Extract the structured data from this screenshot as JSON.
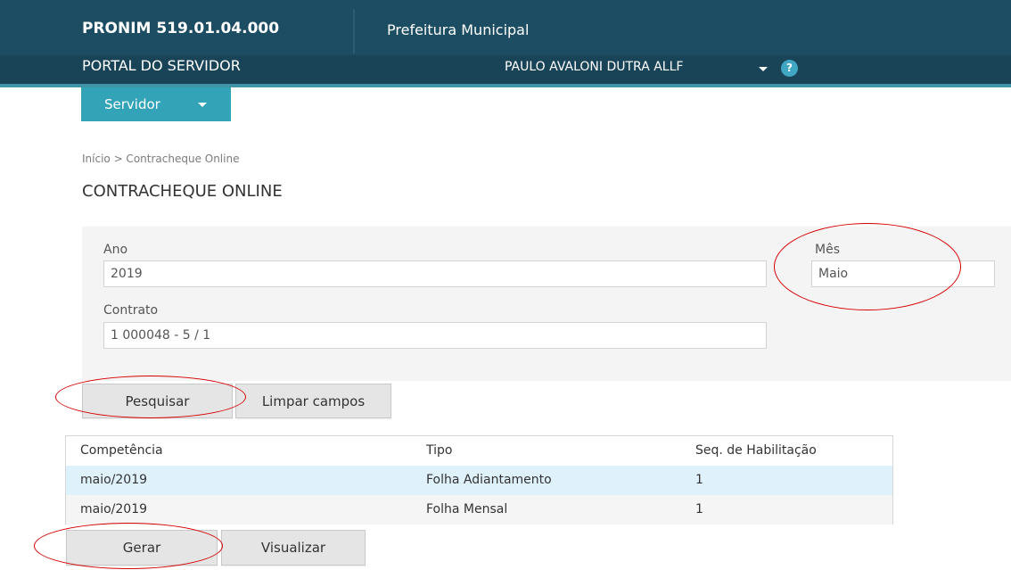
{
  "header": {
    "product": "PRONIM 519.01.04.000",
    "organization": "Prefeitura Municipal",
    "portal": "PORTAL DO SERVIDOR",
    "user": "PAULO AVALONI DUTRA ALLF",
    "help": "?"
  },
  "menu": {
    "servidor": "Servidor"
  },
  "breadcrumb": "Início > Contracheque Online",
  "page_title": "CONTRACHEQUE ONLINE",
  "form": {
    "ano_label": "Ano",
    "ano_value": "2019",
    "mes_label": "Mês",
    "mes_value": "Maio",
    "contrato_label": "Contrato",
    "contrato_value": "1 000048 - 5 / 1"
  },
  "actions": {
    "pesquisar": "Pesquisar",
    "limpar": "Limpar campos",
    "gerar": "Gerar",
    "visualizar": "Visualizar"
  },
  "grid": {
    "headers": [
      "Competência",
      "Tipo",
      "Seq. de Habilitação"
    ],
    "rows": [
      {
        "competencia": "maio/2019",
        "tipo": "Folha Adiantamento",
        "seq": "1"
      },
      {
        "competencia": "maio/2019",
        "tipo": "Folha Mensal",
        "seq": "1"
      }
    ]
  },
  "colors": {
    "header_bg": "#1d4d62",
    "accent": "#33a4b8",
    "selected_row": "#dff1fb",
    "annotation": "#d60000"
  }
}
